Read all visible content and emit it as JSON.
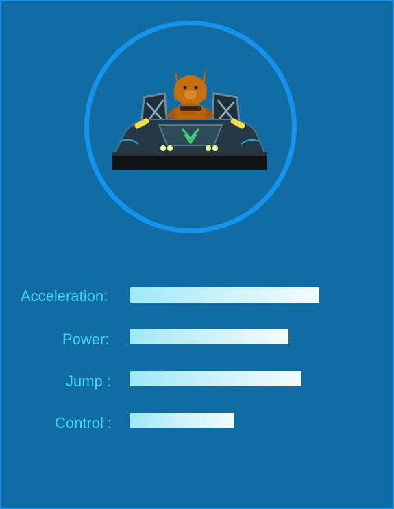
{
  "colors": {
    "background": "#116ca4",
    "border": "#1b8fe6",
    "ring": "#1592ea",
    "label": "#3fd8f2",
    "bar_start": "#9fe8f8",
    "bar_end": "#f3fcff"
  },
  "character": {
    "icon": "cat-driver-hovercraft-icon"
  },
  "stats": [
    {
      "label": "Acceleration:",
      "value": 0.86
    },
    {
      "label": "Power:",
      "value": 0.72
    },
    {
      "label": "Jump :",
      "value": 0.78
    },
    {
      "label": "Control :",
      "value": 0.47
    }
  ]
}
